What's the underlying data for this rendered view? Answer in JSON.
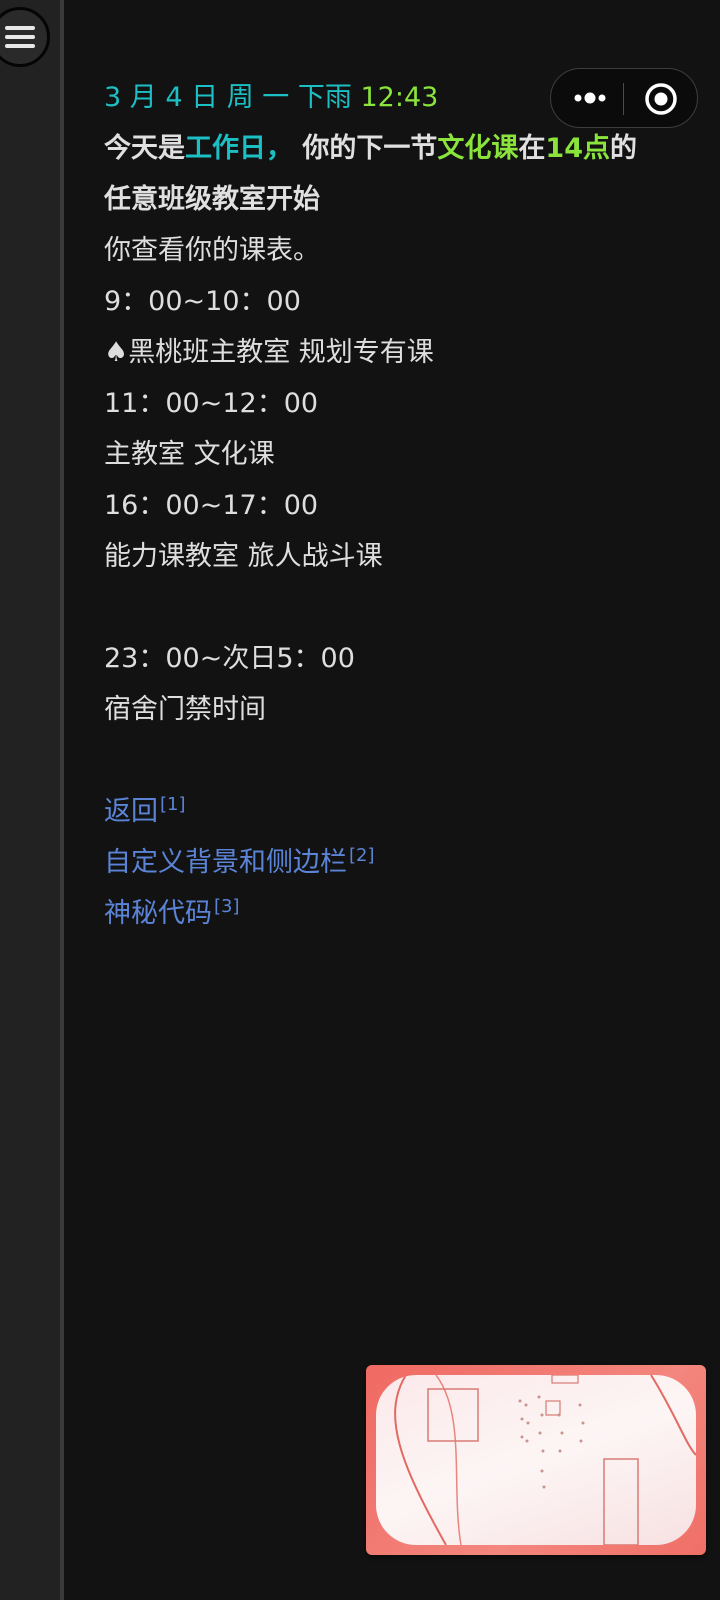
{
  "status": {
    "date": "3 月 4 日",
    "weekday": "周 一",
    "weather": "下雨",
    "time": "12:43"
  },
  "message": {
    "p1": "今天是",
    "day_type": "工作日，",
    "p2": " 你的下一节",
    "course": "文化课",
    "p3": "在",
    "hour": "14点",
    "p4": "的",
    "line2": "任意班级教室开始"
  },
  "schedule": {
    "intro": "你查看你的课表。",
    "items": [
      {
        "time": "9：00~10：00",
        "desc": "♠黑桃班主教室 规划专有课"
      },
      {
        "time": "11：00~12：00",
        "desc": "主教室 文化课"
      },
      {
        "time": "16：00~17：00",
        "desc": "能力课教室 旅人战斗课"
      },
      {
        "time": "23：00~次日5：00",
        "desc": "宿舍门禁时间"
      }
    ]
  },
  "links": [
    {
      "label": "返回",
      "ref": "[1]"
    },
    {
      "label": "自定义背景和侧边栏",
      "ref": "[2]"
    },
    {
      "label": "神秘代码",
      "ref": "[3]"
    }
  ],
  "colors": {
    "background": "#121212",
    "accent_teal": "#1cbfc4",
    "accent_green": "#8be43b",
    "link": "#5b84d6"
  },
  "icons": {
    "menu": "hamburger-icon",
    "capsule_more": "more-dots-icon",
    "capsule_close": "target-circle-icon"
  }
}
